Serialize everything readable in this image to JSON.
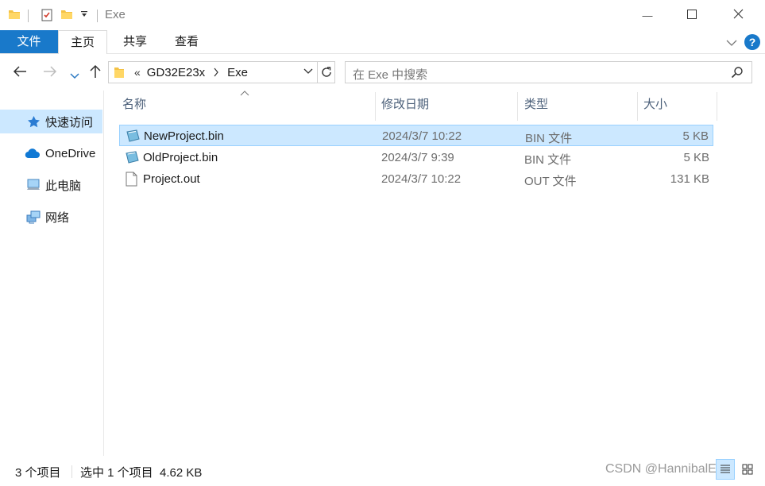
{
  "window": {
    "title": "Exe",
    "minimize_glyph": "—",
    "maximize_glyph": "☐",
    "close_glyph": "✕"
  },
  "ribbon": {
    "tabs": [
      {
        "label": "文件"
      },
      {
        "label": "主页"
      },
      {
        "label": "共享"
      },
      {
        "label": "查看"
      }
    ],
    "help_glyph": "?"
  },
  "address": {
    "overflow": "«",
    "segments": [
      "GD32E23x",
      "Exe"
    ]
  },
  "search": {
    "placeholder": "在 Exe 中搜索"
  },
  "sidebar": {
    "items": [
      {
        "label": "快速访问",
        "icon": "star-icon"
      },
      {
        "label": "OneDrive",
        "icon": "cloud-icon"
      },
      {
        "label": "此电脑",
        "icon": "computer-icon"
      },
      {
        "label": "网络",
        "icon": "network-icon"
      }
    ]
  },
  "columns": {
    "name": "名称",
    "date": "修改日期",
    "type": "类型",
    "size": "大小"
  },
  "files": [
    {
      "name": "NewProject.bin",
      "date": "2024/3/7 10:22",
      "type": "BIN 文件",
      "size": "5 KB",
      "selected": true,
      "icon": "bin-file-icon"
    },
    {
      "name": "OldProject.bin",
      "date": "2024/3/7 9:39",
      "type": "BIN 文件",
      "size": "5 KB",
      "selected": false,
      "icon": "bin-file-icon"
    },
    {
      "name": "Project.out",
      "date": "2024/3/7 10:22",
      "type": "OUT 文件",
      "size": "131 KB",
      "selected": false,
      "icon": "blank-file-icon"
    }
  ],
  "status": {
    "count": "3 个项目",
    "selection": "选中 1 个项目  4.62 KB"
  },
  "watermark": "CSDN @HannibalEng",
  "colors": {
    "accent": "#1979ca",
    "selection": "#cce8ff",
    "selection_border": "#99d1ff",
    "help": "#1979ca"
  }
}
